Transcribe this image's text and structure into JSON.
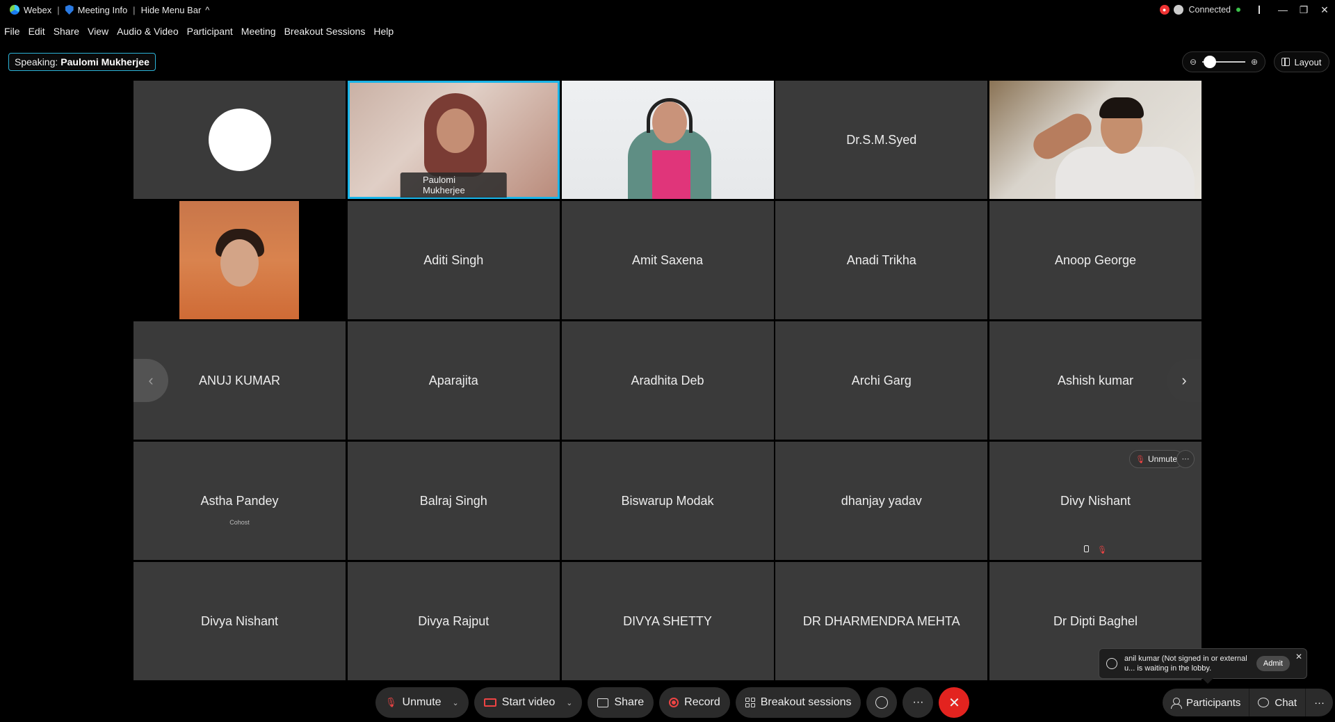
{
  "titlebar": {
    "app_name": "Webex",
    "meeting_info": "Meeting Info",
    "hide_menu_bar": "Hide Menu Bar",
    "connection_status": "Connected",
    "minimize": "—",
    "restore": "❐",
    "close": "✕"
  },
  "menu": [
    "File",
    "Edit",
    "Share",
    "View",
    "Audio & Video",
    "Participant",
    "Meeting",
    "Breakout Sessions",
    "Help"
  ],
  "speaking": {
    "label": "Speaking:",
    "name": "Paulomi Mukherjee"
  },
  "layout_label": "Layout",
  "participants": [
    {
      "name": "",
      "kind": "avatar"
    },
    {
      "name": "Paulomi Mukherjee",
      "kind": "video",
      "active": true
    },
    {
      "name": "",
      "kind": "video"
    },
    {
      "name": "Dr.S.M.Syed",
      "kind": "name"
    },
    {
      "name": "",
      "kind": "video"
    },
    {
      "name": "",
      "kind": "video"
    },
    {
      "name": "Aditi Singh",
      "kind": "name"
    },
    {
      "name": "Amit Saxena",
      "kind": "name"
    },
    {
      "name": "Anadi Trikha",
      "kind": "name"
    },
    {
      "name": "Anoop George",
      "kind": "name"
    },
    {
      "name": "ANUJ KUMAR",
      "kind": "name"
    },
    {
      "name": "Aparajita",
      "kind": "name"
    },
    {
      "name": "Aradhita Deb",
      "kind": "name"
    },
    {
      "name": "Archi Garg",
      "kind": "name"
    },
    {
      "name": "Ashish kumar",
      "kind": "name"
    },
    {
      "name": "Astha Pandey",
      "kind": "name",
      "sub": "Cohost"
    },
    {
      "name": "Balraj Singh",
      "kind": "name"
    },
    {
      "name": "Biswarup Modak",
      "kind": "name"
    },
    {
      "name": "dhanjay yadav",
      "kind": "name"
    },
    {
      "name": "Divy Nishant",
      "kind": "name"
    },
    {
      "name": "Divya Nishant",
      "kind": "name"
    },
    {
      "name": "Divya Rajput",
      "kind": "name"
    },
    {
      "name": "DIVYA SHETTY",
      "kind": "name"
    },
    {
      "name": "DR DHARMENDRA MEHTA",
      "kind": "name"
    },
    {
      "name": "Dr Dipti Baghel",
      "kind": "name"
    }
  ],
  "tile_actions": {
    "unmute": "Unmute",
    "more": "···"
  },
  "lobby": {
    "message": "anil kumar (Not signed in or external u... is waiting in the lobby.",
    "admit": "Admit"
  },
  "controls": {
    "unmute": "Unmute",
    "start_video": "Start video",
    "share": "Share",
    "record": "Record",
    "breakout": "Breakout sessions",
    "more": "···",
    "end": "✕"
  },
  "right_controls": {
    "participants": "Participants",
    "chat": "Chat",
    "more": "···"
  },
  "colors": {
    "active_border": "#19b4e8",
    "end_call": "#e3231f",
    "tile_bg": "#3a3a3a"
  }
}
